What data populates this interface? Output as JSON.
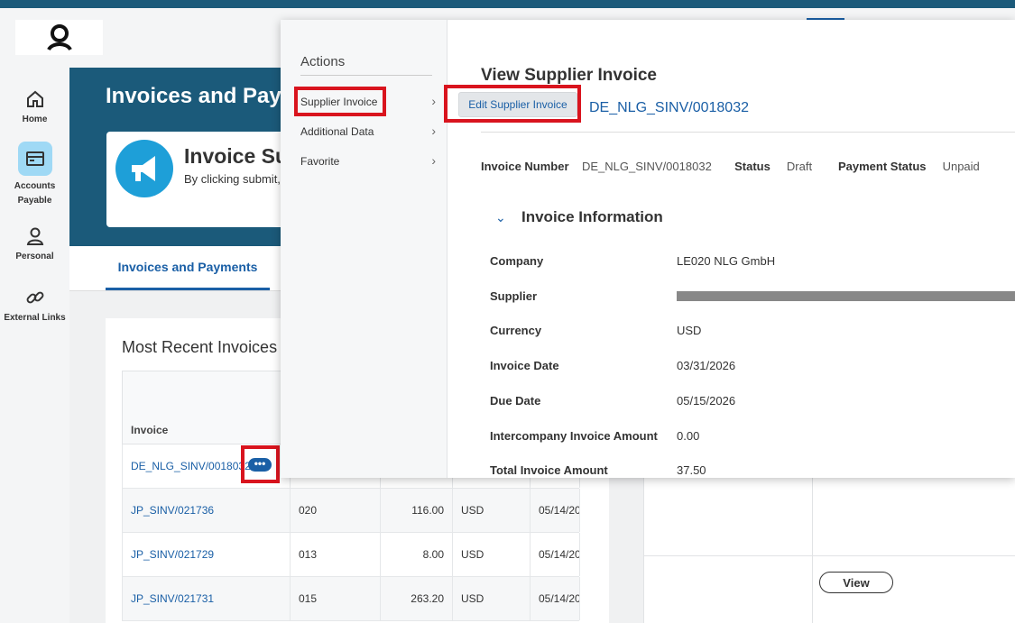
{
  "header": {
    "logo_icon": "person-logo-icon",
    "apps_icon": "grid-dots-icon"
  },
  "sidebar": {
    "items": [
      {
        "label": "Home",
        "icon": "home-icon"
      },
      {
        "label": "Accounts Payable",
        "icon": "card-icon",
        "active": true
      },
      {
        "label": "Personal",
        "icon": "person-icon"
      },
      {
        "label": "External Links",
        "icon": "link-icon"
      }
    ]
  },
  "page": {
    "title": "Invoices and Paym",
    "announcement": {
      "title": "Invoice Su",
      "subtitle": "By clicking submit,",
      "icon": "megaphone-icon"
    },
    "tab_active": "Invoices and Payments"
  },
  "recent": {
    "title": "Most Recent Invoices",
    "header_invoice": "Invoice",
    "rows": [
      {
        "invoice": "DE_NLG_SINV/0018032",
        "col2": "",
        "amount": "",
        "currency": "",
        "date": ""
      },
      {
        "invoice": "JP_SINV/021736",
        "col2": "020",
        "amount": "116.00",
        "currency": "USD",
        "date": "05/14/20"
      },
      {
        "invoice": "JP_SINV/021729",
        "col2": "013",
        "amount": "8.00",
        "currency": "USD",
        "date": "05/14/20"
      },
      {
        "invoice": "JP_SINV/021731",
        "col2": "015",
        "amount": "263.20",
        "currency": "USD",
        "date": "05/14/20"
      }
    ],
    "more_button": "•••"
  },
  "right_panel": {
    "view_button": "View"
  },
  "actions_menu": {
    "heading": "Actions",
    "items": [
      {
        "label": "Supplier Invoice"
      },
      {
        "label": "Additional Data"
      },
      {
        "label": "Favorite"
      }
    ],
    "submenu_item": "Edit Supplier Invoice"
  },
  "detail": {
    "title": "View Supplier Invoice",
    "link": "DE_NLG_SINV/0018032",
    "invoice_number_label": "Invoice Number",
    "invoice_number": "DE_NLG_SINV/0018032",
    "status_label": "Status",
    "status": "Draft",
    "payment_status_label": "Payment Status",
    "payment_status": "Unpaid",
    "section_title": "Invoice Information",
    "fields": [
      {
        "label": "Company",
        "value": "LE020 NLG GmbH"
      },
      {
        "label": "Supplier",
        "value": ""
      },
      {
        "label": "Currency",
        "value": "USD"
      },
      {
        "label": "Invoice Date",
        "value": "03/31/2026"
      },
      {
        "label": "Due Date",
        "value": "05/15/2026"
      },
      {
        "label": "Intercompany Invoice Amount",
        "value": "0.00"
      },
      {
        "label": "Total Invoice Amount",
        "value": "37.50"
      }
    ]
  }
}
